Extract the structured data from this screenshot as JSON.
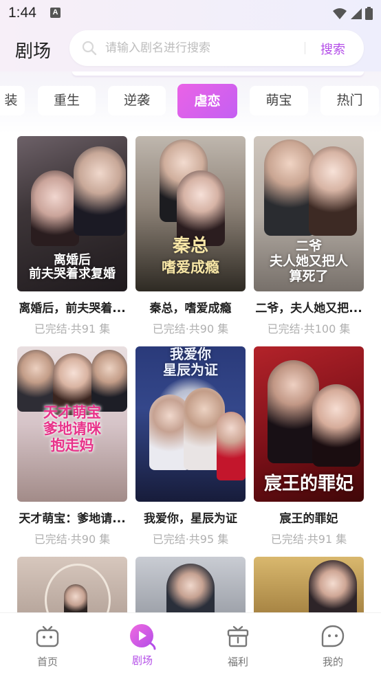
{
  "status_bar": {
    "time": "1:44",
    "notif_letter": "A"
  },
  "header": {
    "title": "剧场",
    "search_placeholder": "请输入剧名进行搜索",
    "search_button": "搜索"
  },
  "categories": [
    {
      "label": "装",
      "active": false
    },
    {
      "label": "重生",
      "active": false
    },
    {
      "label": "逆袭",
      "active": false
    },
    {
      "label": "虐恋",
      "active": true
    },
    {
      "label": "萌宝",
      "active": false
    },
    {
      "label": "热门",
      "active": false
    }
  ],
  "dramas": [
    {
      "title": "离婚后，前夫哭着...",
      "meta": "已完结·共91 集",
      "poster_text": "离婚后\n前夫哭着求复婚"
    },
    {
      "title": "秦总，嗜爱成瘾",
      "meta": "已完结·共90 集",
      "poster_text": "秦总\n嗜爱成瘾"
    },
    {
      "title": "二爷，夫人她又把...",
      "meta": "已完结·共100 集",
      "poster_text": "二爷\n夫人她又把人\n算死了"
    },
    {
      "title": "天才萌宝：爹地请...",
      "meta": "已完结·共90 集",
      "poster_text": "天才萌宝\n爹地请咪\n抱走妈"
    },
    {
      "title": "我爱你，星辰为证",
      "meta": "已完结·共95 集",
      "poster_text": "我爱你\n星辰为证"
    },
    {
      "title": "宸王的罪妃",
      "meta": "已完结·共91 集",
      "poster_text": "宸王的罪妃"
    }
  ],
  "bottom_nav": [
    {
      "label": "首页",
      "icon": "tv-icon",
      "active": false
    },
    {
      "label": "剧场",
      "icon": "play-icon",
      "active": true
    },
    {
      "label": "福利",
      "icon": "gift-icon",
      "active": false
    },
    {
      "label": "我的",
      "icon": "profile-icon",
      "active": false
    }
  ],
  "colors": {
    "accent": "#b44ee8",
    "active_tab_start": "#ea63e6",
    "active_tab_end": "#c45ff2"
  }
}
